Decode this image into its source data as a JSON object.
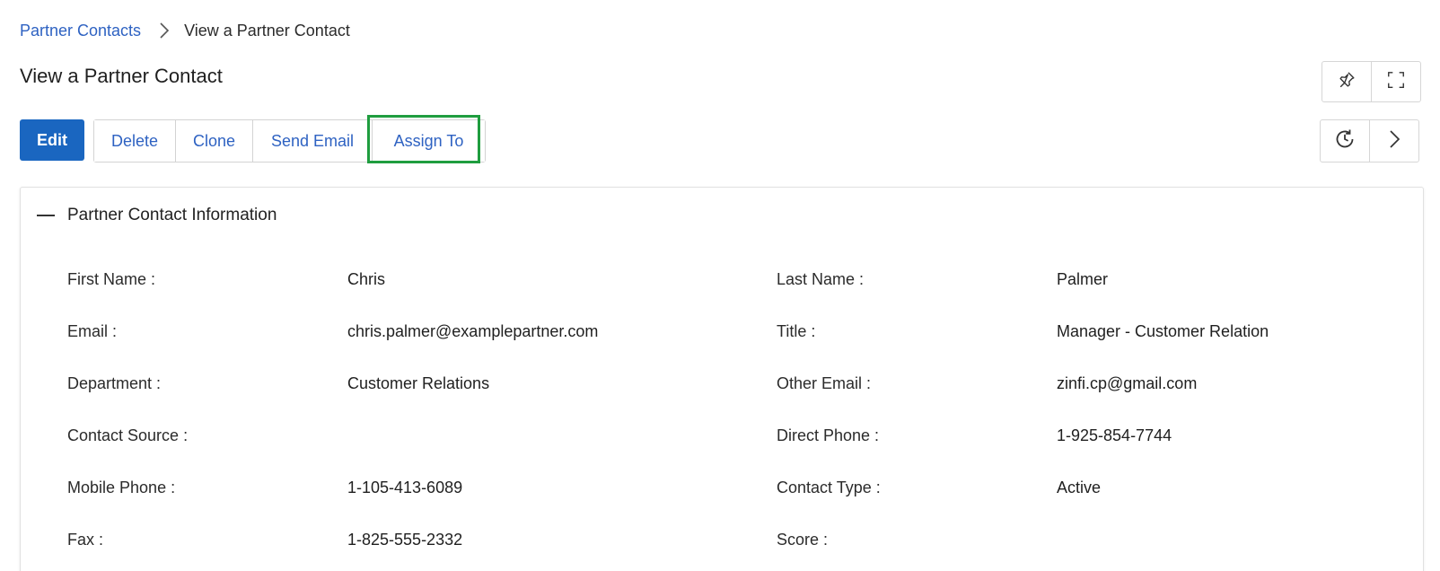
{
  "breadcrumb": {
    "parent": "Partner Contacts",
    "current": "View a Partner Contact"
  },
  "page": {
    "title": "View a Partner Contact"
  },
  "actions": {
    "edit": "Edit",
    "delete": "Delete",
    "clone": "Clone",
    "send_email": "Send Email",
    "assign_to": "Assign To"
  },
  "icons": {
    "pin": "pin-icon",
    "expand": "fullscreen-icon",
    "history": "history-icon",
    "next": "chevron-right-icon",
    "collapse": "minus-icon"
  },
  "colors": {
    "primary": "#1a66c0",
    "link": "#2e62c2",
    "highlight": "#1f9d3f"
  },
  "panel": {
    "title": "Partner Contact Information",
    "fields": {
      "first_name": {
        "label": "First Name :",
        "value": "Chris"
      },
      "last_name": {
        "label": "Last Name :",
        "value": "Palmer"
      },
      "email": {
        "label": "Email :",
        "value": "chris.palmer@examplepartner.com"
      },
      "title": {
        "label": "Title :",
        "value": "Manager - Customer Relation"
      },
      "department": {
        "label": "Department :",
        "value": "Customer Relations"
      },
      "other_email": {
        "label": "Other Email :",
        "value": "zinfi.cp@gmail.com"
      },
      "contact_source": {
        "label": "Contact Source :",
        "value": ""
      },
      "direct_phone": {
        "label": "Direct Phone :",
        "value": "1-925-854-7744"
      },
      "mobile_phone": {
        "label": "Mobile Phone :",
        "value": "1-105-413-6089"
      },
      "contact_type": {
        "label": "Contact Type :",
        "value": "Active"
      },
      "fax": {
        "label": "Fax :",
        "value": "1-825-555-2332"
      },
      "score": {
        "label": "Score :",
        "value": ""
      }
    }
  }
}
